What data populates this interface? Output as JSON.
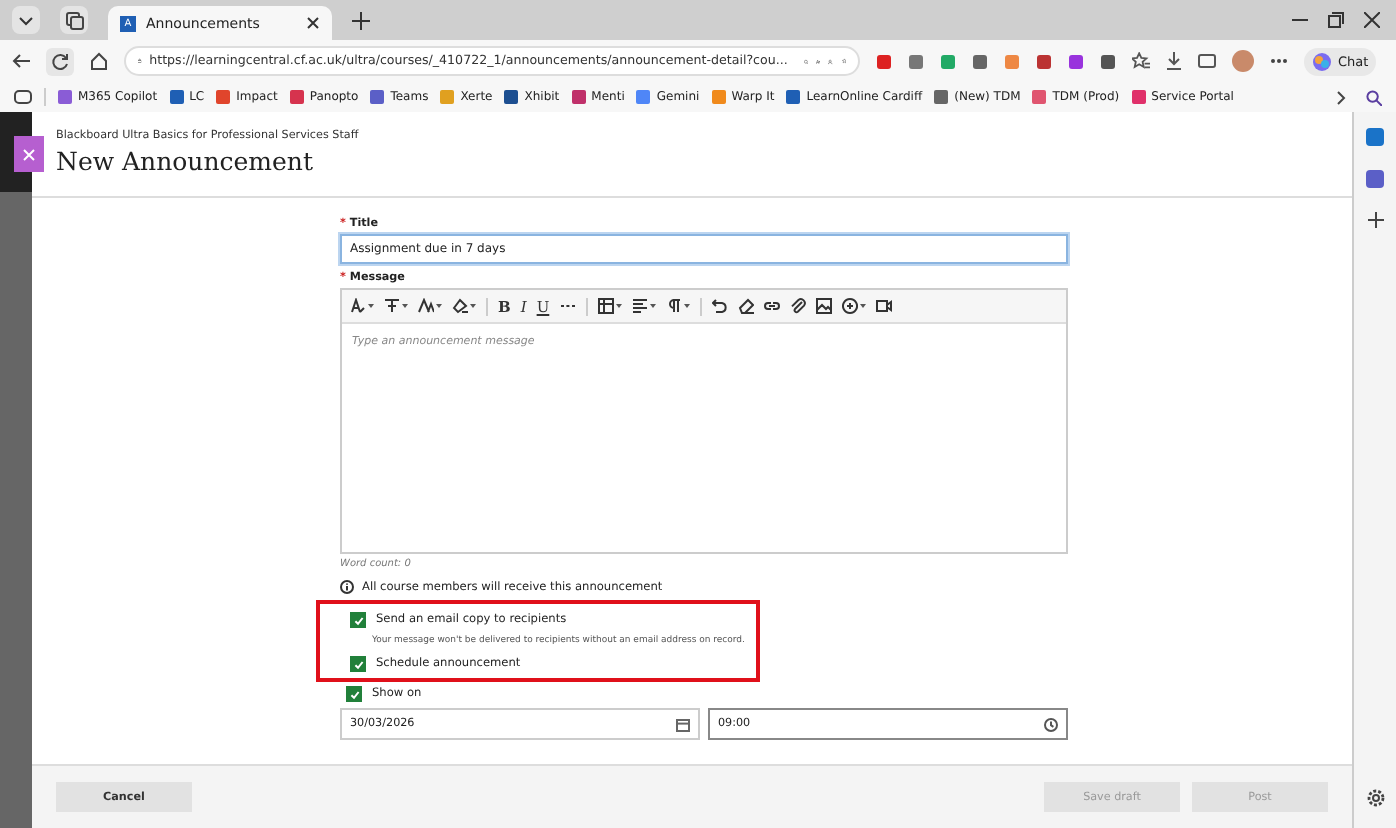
{
  "browser": {
    "tab_icon": "A",
    "tab_title": "Announcements",
    "url": "https://learningcentral.cf.ac.uk/ultra/courses/_410722_1/announcements/announcement-detail?cou...",
    "chat_label": "Chat",
    "bookmarks": [
      {
        "label": "M365 Copilot",
        "color": "#8a5cd6"
      },
      {
        "label": "LC",
        "color": "#1f5fb4"
      },
      {
        "label": "Impact",
        "color": "#e0452c"
      },
      {
        "label": "Panopto",
        "color": "#d6334e"
      },
      {
        "label": "Teams",
        "color": "#5b5fc7"
      },
      {
        "label": "Xerte",
        "color": "#e0a020"
      },
      {
        "label": "Xhibit",
        "color": "#1d4f91"
      },
      {
        "label": "Menti",
        "color": "#c0306a"
      },
      {
        "label": "Gemini",
        "color": "#4f86f7"
      },
      {
        "label": "Warp It",
        "color": "#f08a1c"
      },
      {
        "label": "LearnOnline Cardiff",
        "color": "#1f5fb4"
      },
      {
        "label": "(New) TDM",
        "color": "#666666"
      },
      {
        "label": "TDM (Prod)",
        "color": "#e05570"
      },
      {
        "label": "Service Portal",
        "color": "#e0306a"
      }
    ]
  },
  "page": {
    "course": "Blackboard Ultra Basics for Professional Services Staff",
    "heading": "New Announcement",
    "required_mark": "*",
    "title_label": "Title",
    "title_value": "Assignment due in 7 days",
    "message_label": "Message",
    "message_placeholder": "Type an announcement message",
    "toolbar": [
      {
        "kind": "icon",
        "dropdown": true
      },
      {
        "kind": "icon",
        "dropdown": true
      },
      {
        "kind": "icon",
        "dropdown": true
      },
      {
        "kind": "icon",
        "dropdown": true
      },
      {
        "kind": "sep"
      },
      {
        "kind": "bold",
        "label": "B"
      },
      {
        "kind": "italic",
        "label": "I"
      },
      {
        "kind": "underline",
        "label": "U"
      },
      {
        "kind": "icon",
        "dropdown": false
      },
      {
        "kind": "sep"
      },
      {
        "kind": "icon",
        "dropdown": true
      },
      {
        "kind": "icon",
        "dropdown": true
      },
      {
        "kind": "icon",
        "dropdown": true
      },
      {
        "kind": "sep"
      },
      {
        "kind": "icon",
        "dropdown": false
      },
      {
        "kind": "icon",
        "dropdown": false
      },
      {
        "kind": "icon",
        "dropdown": false
      },
      {
        "kind": "icon",
        "dropdown": false
      },
      {
        "kind": "icon",
        "dropdown": false
      },
      {
        "kind": "icon",
        "dropdown": true
      },
      {
        "kind": "icon",
        "dropdown": false
      }
    ],
    "word_count": "Word count: 0",
    "info": "All course members will receive this announcement",
    "options": [
      {
        "label": "Send an email copy to recipients",
        "checked": true,
        "hint": "Your message won't be delivered to recipients without an email address on record."
      },
      {
        "label": "Schedule announcement",
        "checked": true
      }
    ],
    "show_on": {
      "label": "Show on",
      "checked": true,
      "date": "30/03/2026",
      "time": "09:00"
    },
    "buttons": {
      "cancel": "Cancel",
      "save": "Save draft",
      "post": "Post"
    }
  }
}
